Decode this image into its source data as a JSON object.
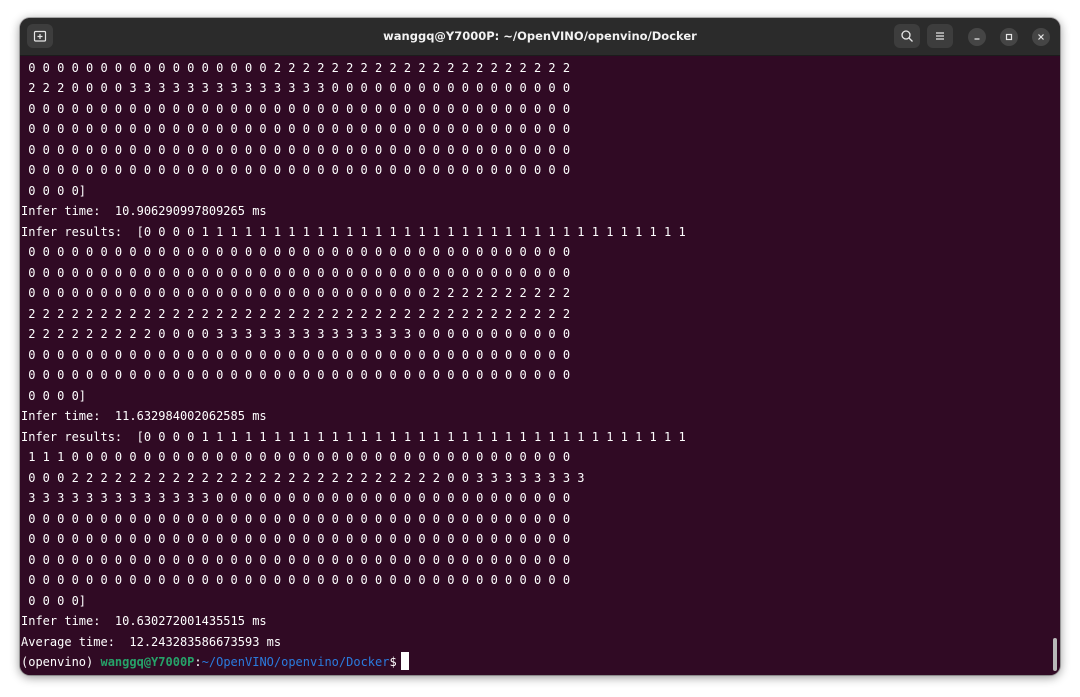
{
  "window": {
    "title": "wanggq@Y7000P: ~/OpenVINO/openvino/Docker",
    "icons": {
      "new_tab": "new-tab-icon",
      "search": "search-icon",
      "menu": "hamburger-menu-icon",
      "minimize": "minimize-icon",
      "maximize": "maximize-icon",
      "close": "close-icon"
    }
  },
  "terminal": {
    "background": "#300a24",
    "lines": [
      " 0 0 0 0 0 0 0 0 0 0 0 0 0 0 0 0 0 2 2 2 2 2 2 2 2 2 2 2 2 2 2 2 2 2 2 2 2 2",
      " 2 2 2 0 0 0 0 3 3 3 3 3 3 3 3 3 3 3 3 3 3 0 0 0 0 0 0 0 0 0 0 0 0 0 0 0 0 0",
      " 0 0 0 0 0 0 0 0 0 0 0 0 0 0 0 0 0 0 0 0 0 0 0 0 0 0 0 0 0 0 0 0 0 0 0 0 0 0",
      " 0 0 0 0 0 0 0 0 0 0 0 0 0 0 0 0 0 0 0 0 0 0 0 0 0 0 0 0 0 0 0 0 0 0 0 0 0 0",
      " 0 0 0 0 0 0 0 0 0 0 0 0 0 0 0 0 0 0 0 0 0 0 0 0 0 0 0 0 0 0 0 0 0 0 0 0 0 0",
      " 0 0 0 0 0 0 0 0 0 0 0 0 0 0 0 0 0 0 0 0 0 0 0 0 0 0 0 0 0 0 0 0 0 0 0 0 0 0",
      " 0 0 0 0]",
      "Infer time:  10.906290997809265 ms",
      "Infer results:  [0 0 0 0 1 1 1 1 1 1 1 1 1 1 1 1 1 1 1 1 1 1 1 1 1 1 1 1 1 1 1 1 1 1 1 1 1 1",
      " 0 0 0 0 0 0 0 0 0 0 0 0 0 0 0 0 0 0 0 0 0 0 0 0 0 0 0 0 0 0 0 0 0 0 0 0 0 0",
      " 0 0 0 0 0 0 0 0 0 0 0 0 0 0 0 0 0 0 0 0 0 0 0 0 0 0 0 0 0 0 0 0 0 0 0 0 0 0",
      " 0 0 0 0 0 0 0 0 0 0 0 0 0 0 0 0 0 0 0 0 0 0 0 0 0 0 0 0 2 2 2 2 2 2 2 2 2 2",
      " 2 2 2 2 2 2 2 2 2 2 2 2 2 2 2 2 2 2 2 2 2 2 2 2 2 2 2 2 2 2 2 2 2 2 2 2 2 2",
      " 2 2 2 2 2 2 2 2 2 0 0 0 0 3 3 3 3 3 3 3 3 3 3 3 3 3 3 0 0 0 0 0 0 0 0 0 0 0",
      " 0 0 0 0 0 0 0 0 0 0 0 0 0 0 0 0 0 0 0 0 0 0 0 0 0 0 0 0 0 0 0 0 0 0 0 0 0 0",
      " 0 0 0 0 0 0 0 0 0 0 0 0 0 0 0 0 0 0 0 0 0 0 0 0 0 0 0 0 0 0 0 0 0 0 0 0 0 0",
      " 0 0 0 0]",
      "Infer time:  11.632984002062585 ms",
      "Infer results:  [0 0 0 0 1 1 1 1 1 1 1 1 1 1 1 1 1 1 1 1 1 1 1 1 1 1 1 1 1 1 1 1 1 1 1 1 1 1",
      " 1 1 1 0 0 0 0 0 0 0 0 0 0 0 0 0 0 0 0 0 0 0 0 0 0 0 0 0 0 0 0 0 0 0 0 0 0 0",
      " 0 0 0 2 2 2 2 2 2 2 2 2 2 2 2 2 2 2 2 2 2 2 2 2 2 2 2 2 2 0 0 3 3 3 3 3 3 3 3",
      " 3 3 3 3 3 3 3 3 3 3 3 3 3 0 0 0 0 0 0 0 0 0 0 0 0 0 0 0 0 0 0 0 0 0 0 0 0 0",
      " 0 0 0 0 0 0 0 0 0 0 0 0 0 0 0 0 0 0 0 0 0 0 0 0 0 0 0 0 0 0 0 0 0 0 0 0 0 0",
      " 0 0 0 0 0 0 0 0 0 0 0 0 0 0 0 0 0 0 0 0 0 0 0 0 0 0 0 0 0 0 0 0 0 0 0 0 0 0",
      " 0 0 0 0 0 0 0 0 0 0 0 0 0 0 0 0 0 0 0 0 0 0 0 0 0 0 0 0 0 0 0 0 0 0 0 0 0 0",
      " 0 0 0 0 0 0 0 0 0 0 0 0 0 0 0 0 0 0 0 0 0 0 0 0 0 0 0 0 0 0 0 0 0 0 0 0 0 0",
      " 0 0 0 0]",
      "Infer time:  10.630272001435515 ms",
      "Average time:  12.243283586673593 ms"
    ],
    "prompt": {
      "env": "(openvino) ",
      "user_host": "wanggq@Y7000P",
      "separator": ":",
      "path": "~/OpenVINO/openvino/Docker",
      "symbol": "$"
    }
  }
}
